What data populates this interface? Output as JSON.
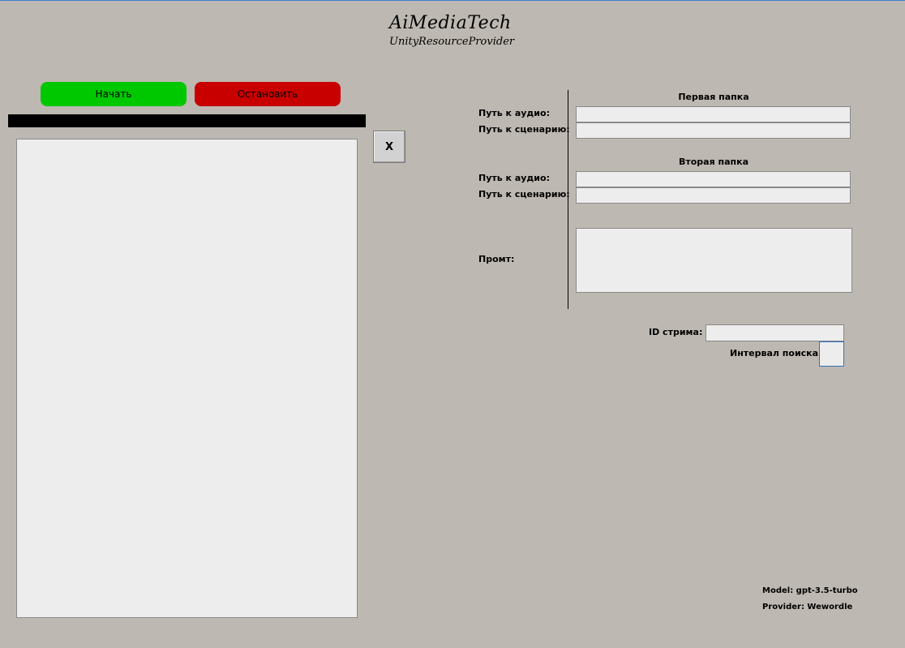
{
  "header": {
    "title": "AiMediaTech",
    "subtitle": "UnityResourceProvider"
  },
  "controls": {
    "start_label": "Начать",
    "stop_label": "Остановить",
    "clear_label": "X",
    "start_color": "#00c800",
    "stop_color": "#c80000"
  },
  "log": {
    "value": ""
  },
  "first_folder": {
    "title": "Первая папка",
    "audio_label": "Путь к аудио:",
    "audio_value": "",
    "script_label": "Путь к сценарию:",
    "script_value": ""
  },
  "second_folder": {
    "title": "Вторая папка",
    "audio_label": "Путь к аудио:",
    "audio_value": "",
    "script_label": "Путь к сценарию:",
    "script_value": ""
  },
  "prompt": {
    "label": "Промт:",
    "value": ""
  },
  "stream": {
    "id_label": "ID стрима:",
    "id_value": "",
    "interval_label": "Интервал поиска:",
    "interval_value": ""
  },
  "footer": {
    "model": "Model: gpt-3.5-turbo",
    "provider": "Provider: Wewordle"
  }
}
